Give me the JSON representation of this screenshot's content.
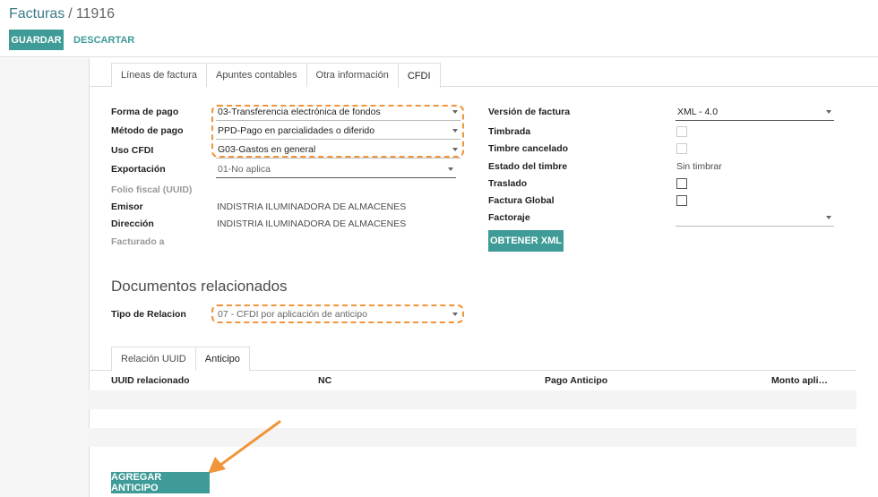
{
  "breadcrumb": {
    "parent": "Facturas",
    "separator": "/",
    "current": "11916"
  },
  "toolbar": {
    "save_label": "GUARDAR",
    "discard_label": "DESCARTAR"
  },
  "tabs": [
    "Líneas de factura",
    "Apuntes contables",
    "Otra información",
    "CFDI"
  ],
  "left_fields": {
    "forma_pago": {
      "label": "Forma de pago",
      "value": "03-Transferencia electrónica de fondos"
    },
    "metodo_pago": {
      "label": "Método de pago",
      "value": "PPD-Pago en parcialidades o diferido"
    },
    "uso_cfdi": {
      "label": "Uso CFDI",
      "value": "G03-Gastos en general"
    },
    "exportacion": {
      "label": "Exportación",
      "value": "01-No aplica"
    },
    "folio_fiscal": {
      "label": "Folio fiscal (UUID)"
    },
    "emisor": {
      "label": "Emisor",
      "value": "INDISTRIA ILUMINADORA DE ALMACENES"
    },
    "direccion": {
      "label": "Dirección",
      "value": "INDISTRIA ILUMINADORA DE ALMACENES"
    },
    "facturado_a": {
      "label": "Facturado a"
    }
  },
  "right_fields": {
    "version": {
      "label": "Versión de factura",
      "value": "XML - 4.0"
    },
    "timbrada": {
      "label": "Timbrada"
    },
    "timbre_cancelado": {
      "label": "Timbre cancelado"
    },
    "estado_timbre": {
      "label": "Estado del timbre",
      "value": "Sin timbrar"
    },
    "traslado": {
      "label": "Traslado"
    },
    "factura_global": {
      "label": "Factura Global"
    },
    "factoraje": {
      "label": "Factoraje"
    },
    "obtener_xml": "OBTENER XML"
  },
  "documentos": {
    "title": "Documentos relacionados",
    "tipo_relacion": {
      "label": "Tipo de Relacion",
      "value": "07 - CFDI por aplicación de anticipo"
    },
    "subtabs": [
      "Relación UUID",
      "Anticipo"
    ],
    "columns": [
      "UUID relacionado",
      "NC",
      "Pago Anticipo",
      "Monto apli…"
    ],
    "add_button": "AGREGAR ANTICIPO"
  },
  "colors": {
    "accent": "#3e9b97",
    "highlight": "#f0953a"
  }
}
